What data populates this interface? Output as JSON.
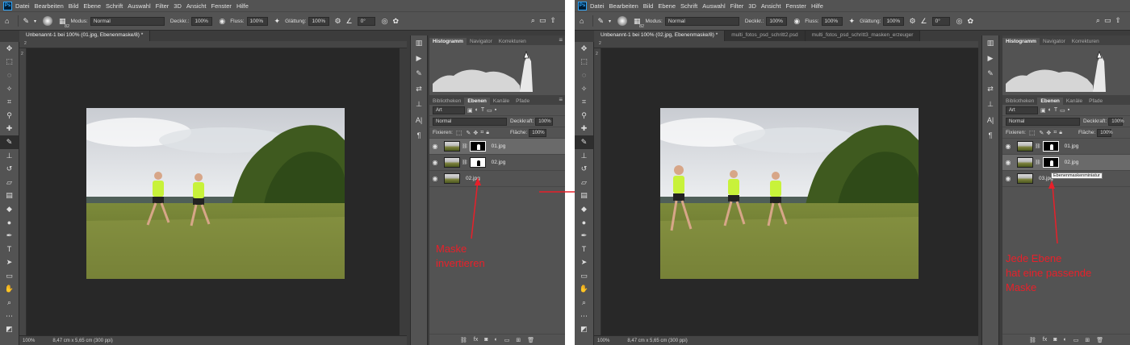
{
  "menu": [
    "Datei",
    "Bearbeiten",
    "Bild",
    "Ebene",
    "Schrift",
    "Auswahl",
    "Filter",
    "3D",
    "Ansicht",
    "Fenster",
    "Hilfe"
  ],
  "options": {
    "brush_size": "82",
    "mode_label": "Modus:",
    "mode_value": "Normal",
    "opacity_label": "Deckkr.:",
    "opacity_value": "100%",
    "flow_label": "Fluss:",
    "flow_value": "100%",
    "smoothing_label": "Glättung:",
    "smoothing_value": "100%",
    "angle_value": "0°"
  },
  "left": {
    "doc_tabs": [
      "Unbenannt-1 bei 100% (01.jpg, Ebenenmaske/8) *"
    ],
    "zoom": "100%",
    "dims": "8,47 cm x 5,65 cm (300 ppi)",
    "annotation": [
      "Maske",
      "invertieren"
    ],
    "layers": [
      {
        "name": "01.jpg",
        "mask": "black"
      },
      {
        "name": "02.jpg",
        "mask": "white"
      },
      {
        "name": "02.jpg",
        "mask": "none"
      }
    ]
  },
  "right": {
    "doc_tabs": [
      "Unbenannt-1 bei 100% (02.jpg, Ebenenmaske/8) *",
      "multi_fotos_psd_schritt2.psd",
      "multi_fotos_psd_schritt3_masken_erzeuger"
    ],
    "zoom": "100%",
    "dims": "8,47 cm x 5,65 cm (300 ppi)",
    "annotation": [
      "Jede Ebene",
      "hat eine passende",
      "Maske"
    ],
    "tooltip": "Ebenenmaskenminiatur",
    "layers": [
      {
        "name": "01.jpg",
        "mask": "black"
      },
      {
        "name": "02.jpg",
        "mask": "black"
      },
      {
        "name": "03.jpg",
        "mask": "none"
      }
    ]
  },
  "panels": {
    "top_tabs": [
      "Histogramm",
      "Navigator",
      "Korrekturen"
    ],
    "layer_tabs": [
      "Bibliotheken",
      "Ebenen",
      "Kanäle",
      "Pfade"
    ],
    "filter_kind": "Art",
    "blend_mode": "Normal",
    "opacity_label": "Deckkraft:",
    "opacity_value": "100%",
    "lock_label": "Fixieren:",
    "fill_label": "Fläche:",
    "fill_value": "100%"
  },
  "colors": {
    "annotation": "#e8202a",
    "accent_green": "#c8f23a"
  },
  "icons": {
    "tools": [
      "move-icon",
      "marquee-icon",
      "lasso-icon",
      "magic-wand-icon",
      "crop-icon",
      "eyedropper-icon",
      "healing-icon",
      "brush-icon",
      "clone-stamp-icon",
      "history-brush-icon",
      "eraser-icon",
      "gradient-icon",
      "blur-icon",
      "dodge-icon",
      "pen-icon",
      "type-icon",
      "path-select-icon",
      "shape-icon",
      "hand-icon",
      "zoom-icon"
    ],
    "bottom": [
      "link-layers-icon",
      "fx-icon",
      "add-mask-icon",
      "adjustment-icon",
      "group-icon",
      "new-layer-icon",
      "delete-icon"
    ]
  }
}
